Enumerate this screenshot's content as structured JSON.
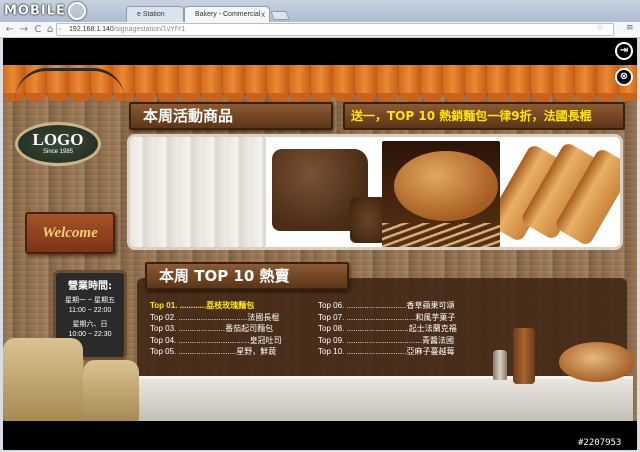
{
  "watermark": "MOBILE",
  "tabs": [
    {
      "label": "e Station"
    },
    {
      "label": "Bakery - Commercial"
    }
  ],
  "tab_close": "x",
  "address": {
    "host": "192.168.1.140",
    "path": "/signagestation/1vYfY1"
  },
  "nav": {
    "back": "←",
    "forward": "→",
    "reload": "C",
    "home": "⌂"
  },
  "toolbar_icons": {
    "star": "☆",
    "menu": "≡"
  },
  "page": {
    "logo": {
      "title": "LOGO",
      "since": "Since 1985"
    },
    "welcome": "Welcome",
    "hours": {
      "title": "營業時間:",
      "weekday_label": "星期一 ~ 星期五",
      "weekday_time": "11:00 ~ 22:00",
      "weekend_label": "星期六、日",
      "weekend_time": "10:00 ~ 22:30"
    },
    "weekly_header": "本周活動商品",
    "promo_text": "送一，TOP 10 熱銷麵包一律9折，法國長棍",
    "top10_header": "本周 TOP 10 熱賣",
    "top10_left": [
      "Top 01. ............荔枝玫瑰麵包",
      "Top 02. ...............................法國長棍",
      "Top 03. .....................番茄起司麵包",
      "Top 04. ................................皇冠吐司",
      "Top 05. ..........................星野，鮮蔬"
    ],
    "top10_right": [
      "Top 06. ...........................香草蘋果可頌",
      "Top 07. ...............................和風芋菓子",
      "Top 08. ............................起士法蘭克福",
      "Top 09. ..................................青醬法國",
      "Top 10. ...........................亞麻子蔓越莓"
    ]
  },
  "side_icons": [
    "exit-icon",
    "settings-icon"
  ],
  "photo_badge": "#2207953"
}
